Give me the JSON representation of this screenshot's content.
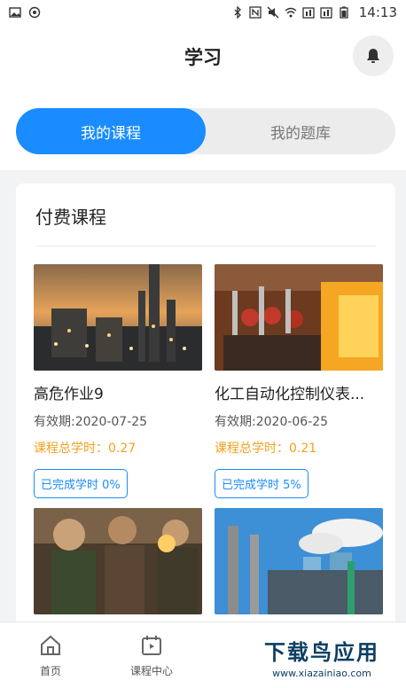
{
  "status_bar": {
    "time": "14:13"
  },
  "header": {
    "title": "学习"
  },
  "tabs": [
    {
      "label": "我的课程",
      "active": true
    },
    {
      "label": "我的题库",
      "active": false
    }
  ],
  "section": {
    "title": "付费课程"
  },
  "courses": [
    {
      "name": "高危作业9",
      "validity": "有效期:2020-07-25",
      "hours": "课程总学时：0.27",
      "progress": "已完成学时 0%"
    },
    {
      "name": "化工自动化控制仪表...",
      "validity": "有效期:2020-06-25",
      "hours": "课程总学时：0.21",
      "progress": "已完成学时 5%"
    }
  ],
  "bottom_nav": [
    {
      "label": "首页",
      "icon": "home-icon"
    },
    {
      "label": "课程中心",
      "icon": "course-center-icon"
    }
  ],
  "watermark": {
    "title": "下载鸟应用",
    "url": "www.xiazainiao.com"
  },
  "colors": {
    "accent": "#1a8cff",
    "hours": "#f3a11f"
  }
}
